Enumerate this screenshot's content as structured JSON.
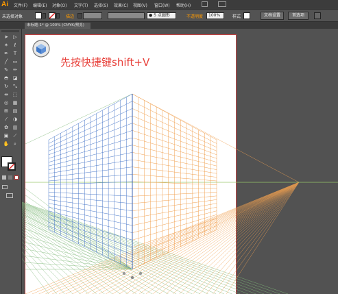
{
  "app": {
    "logo": "Ai"
  },
  "menubar": {
    "items": [
      "文件(F)",
      "编辑(E)",
      "对象(O)",
      "文字(T)",
      "选择(S)",
      "效果(C)",
      "视图(V)",
      "窗口(W)",
      "帮助(H)"
    ]
  },
  "control_bar": {
    "no_selection": "未选择对象",
    "stroke_label": "描边",
    "brush_value": "● 5 点圆形",
    "opacity_label": "不透明度",
    "opacity_value": "100%",
    "style_label": "样式",
    "doc_setup_button": "文档设置",
    "preferences_button": "首选项"
  },
  "document_tab": {
    "label": "未标题-1* @ 100% (CMYK/预览)"
  },
  "artboard": {
    "heading": "先按快捷键shift+V"
  },
  "colors": {
    "accent_orange": "#ff9a00",
    "heading_red": "#e8403a",
    "grid_blue": "#4a78c8",
    "grid_orange": "#f0a050",
    "grid_green": "#7fb878"
  },
  "tools": {
    "icons": [
      "selection-icon",
      "direct-selection-icon",
      "magic-wand-icon",
      "lasso-icon",
      "pen-icon",
      "type-icon",
      "line-icon",
      "rectangle-icon",
      "paintbrush-icon",
      "pencil-icon",
      "blob-brush-icon",
      "eraser-icon",
      "rotate-icon",
      "scale-icon",
      "width-icon",
      "free-transform-icon",
      "shape-builder-icon",
      "perspective-grid-icon",
      "mesh-icon",
      "gradient-icon",
      "eyedropper-icon",
      "blend-icon",
      "symbol-sprayer-icon",
      "column-graph-icon",
      "artboard-icon",
      "slice-icon",
      "hand-icon",
      "zoom-icon"
    ]
  }
}
